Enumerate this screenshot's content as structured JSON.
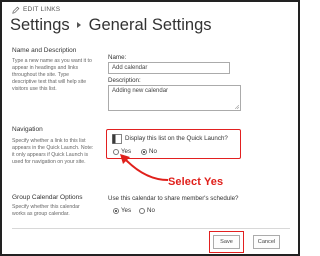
{
  "top_bar": {
    "edit_links": "EDIT LINKS",
    "icon": "pencil-icon"
  },
  "header": {
    "title": "Settings",
    "separator_icon": "triangle-right-icon",
    "subtitle": "General Settings"
  },
  "name_section": {
    "title": "Name and Description",
    "description": "Type a new name as you want it to appear in headings and links throughout the site. Type descriptive text that will help site visitors use this list.",
    "name_label": "Name:",
    "name_value": "Add calendar",
    "description_label": "Description:",
    "description_value": "Adding new calendar"
  },
  "navigation_section": {
    "title": "Navigation",
    "description": "Specify whether a link to this list appears in the Quick Launch. Note: it only appears if Quick Launch is used for navigation on your site.",
    "question": "Display this list on the Quick Launch?",
    "icon": "quick-launch-icon",
    "options": [
      {
        "label": "Yes",
        "selected": false
      },
      {
        "label": "No",
        "selected": true
      }
    ]
  },
  "annotation": {
    "text": "Select Yes",
    "color": "#e0201b"
  },
  "group_calendar_section": {
    "title": "Group Calendar Options",
    "description": "Use this calendar to share member's schedule?",
    "left_description": "Specify whether this calendar works as group calendar.",
    "options": [
      {
        "label": "Yes",
        "selected": true
      },
      {
        "label": "No",
        "selected": false
      }
    ]
  },
  "footer": {
    "save_label": "Save",
    "cancel_label": "Cancel"
  },
  "colors": {
    "highlight": "#e22020",
    "border": "#222222"
  }
}
